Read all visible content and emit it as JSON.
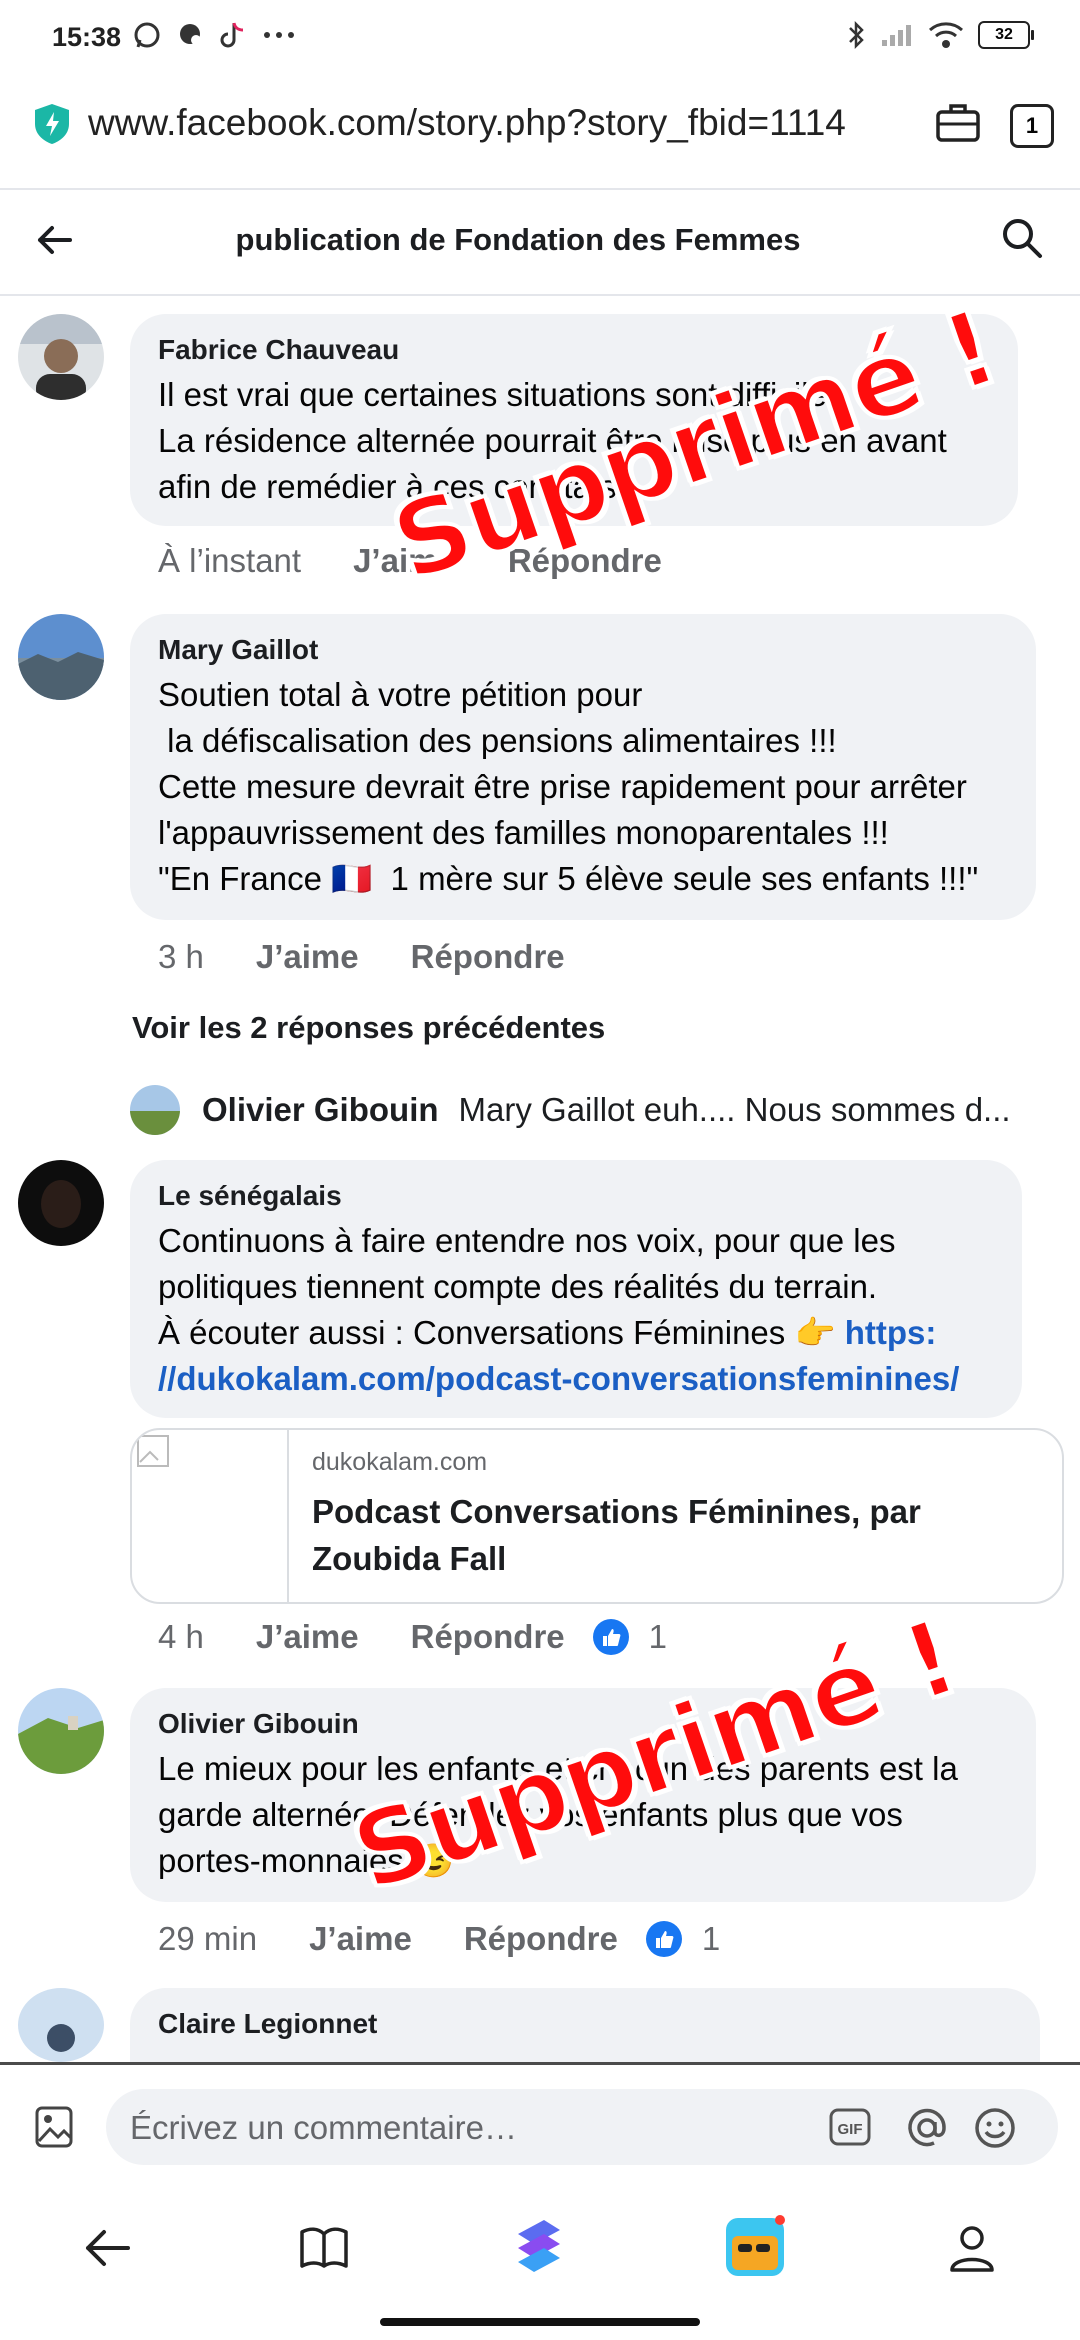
{
  "status_bar": {
    "time": "15:38",
    "battery": "32"
  },
  "browser": {
    "url": "www.facebook.com/story.php?story_fbid=1114",
    "tab_count": "1"
  },
  "header": {
    "title": "publication de Fondation des Femmes"
  },
  "comments": [
    {
      "author": "Fabrice Chauveau",
      "lines": [
        "Il est vrai que certaines situations sont difficiles.",
        "La résidence alternée pourrait être mise plus en avant",
        "afin de remédier à ces constats"
      ],
      "time": "À l’instant",
      "like_label": "J’aime",
      "reply_label": "Répondre"
    },
    {
      "author": "Mary Gaillot",
      "lines": [
        "Soutien total à votre pétition pour",
        " la défiscalisation des pensions alimentaires !!!",
        "Cette mesure devrait être prise rapidement pour arrêter",
        "l'appauvrissement des familles monoparentales !!!",
        "\"En France 🇫🇷  1 mère sur 5 élève seule ses enfants !!!\""
      ],
      "time": "3 h",
      "like_label": "J’aime",
      "reply_label": "Répondre"
    },
    {
      "author": "Le sénégalais",
      "lines": [
        "Continuons à faire entendre nos voix, pour que les",
        "politiques tiennent compte des réalités du terrain.",
        "À écouter aussi : Conversations Féminines 👉 "
      ],
      "link_part1": "https:",
      "link_part2": "//dukokalam.com/podcast-conversationsfeminines/",
      "time": "4 h",
      "like_label": "J’aime",
      "reply_label": "Répondre",
      "reactions": "1"
    },
    {
      "author": "Olivier Gibouin",
      "lines": [
        "Le mieux pour les enfants et chacun des parents est la",
        "garde alternée. Défendez vos enfants plus que vos",
        "portes-monnaies 😉"
      ],
      "time": "29 min",
      "like_label": "J’aime",
      "reply_label": "Répondre",
      "reactions": "1"
    },
    {
      "author": "Claire Legionnet"
    }
  ],
  "see_previous": "Voir les 2 réponses précédentes",
  "reply_preview": {
    "name": "Olivier Gibouin",
    "text": "Mary Gaillot euh.... Nous sommes d..."
  },
  "link_card": {
    "domain": "dukokalam.com",
    "title_line1": "Podcast Conversations Féminines, par",
    "title_line2": "Zoubida Fall"
  },
  "stamps": [
    "Supprimé !",
    "Supprimé !"
  ],
  "composer": {
    "placeholder": "Écrivez un commentaire…",
    "gif_label": "GIF"
  },
  "colors": {
    "link": "#1b5fc4",
    "bubble": "#f0f2f5",
    "stamp": "#ff0c0c",
    "like": "#1877f2"
  }
}
